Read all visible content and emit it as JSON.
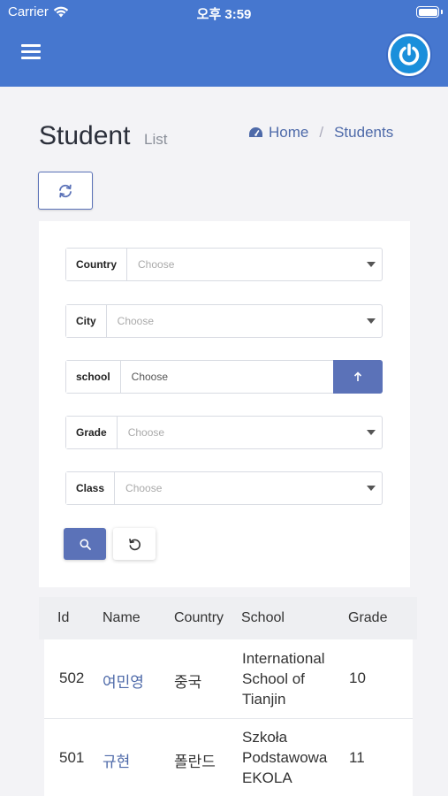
{
  "status_bar": {
    "carrier": "Carrier",
    "time": "오후 3:59"
  },
  "header": {
    "menu_icon": "hamburger-icon",
    "power_icon": "power-icon"
  },
  "page": {
    "title": "Student",
    "subtitle": "List"
  },
  "breadcrumb": {
    "home": "Home",
    "current": "Students",
    "home_icon": "dashboard-icon"
  },
  "filters": {
    "country": {
      "label": "Country",
      "placeholder": "Choose"
    },
    "city": {
      "label": "City",
      "placeholder": "Choose"
    },
    "school": {
      "label": "school",
      "placeholder": "Choose"
    },
    "grade": {
      "label": "Grade",
      "placeholder": "Choose"
    },
    "class": {
      "label": "Class",
      "placeholder": "Choose"
    }
  },
  "table": {
    "headers": [
      "Id",
      "Name",
      "Country",
      "School",
      "Grade"
    ],
    "rows": [
      {
        "id": "502",
        "name": "여민영",
        "country": "중국",
        "school": [
          "International",
          "School of",
          "Tianjin"
        ],
        "grade": "10"
      },
      {
        "id": "501",
        "name": "규현",
        "country": "폴란드",
        "school": [
          "Szkoła",
          "Podstawowa",
          "EKOLA"
        ],
        "grade": "11"
      }
    ]
  },
  "colors": {
    "header_blue": "#4677cf",
    "accent": "#5b72b8",
    "link": "#4e6aa9"
  }
}
